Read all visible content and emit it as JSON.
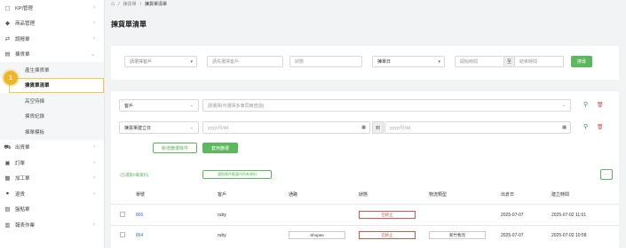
{
  "sidebar": {
    "items": [
      {
        "icon": "kpi-icon",
        "glyph": "▢",
        "label": "KPI管理"
      },
      {
        "icon": "cube-icon",
        "glyph": "◆",
        "label": "商品管理"
      },
      {
        "icon": "swap-icon",
        "glyph": "⇄",
        "label": "調撥單"
      },
      {
        "icon": "package-icon",
        "glyph": "▤",
        "label": "揀貨單"
      }
    ],
    "sub_items": [
      {
        "label": "產生揀貨單"
      },
      {
        "label": "揀貨單清單"
      },
      {
        "label": "高空待揀"
      },
      {
        "label": "揀貨紀錄"
      },
      {
        "label": "揀單模板"
      }
    ],
    "items_after": [
      {
        "icon": "truck-icon",
        "glyph": "⛟",
        "label": "出貨單"
      },
      {
        "icon": "order-icon",
        "glyph": "▣",
        "label": "訂單"
      },
      {
        "icon": "factory-icon",
        "glyph": "▦",
        "label": "加工單"
      },
      {
        "icon": "return-icon",
        "glyph": "●",
        "label": "退貨"
      },
      {
        "icon": "inventory-icon",
        "glyph": "▧",
        "label": "盤點單"
      },
      {
        "icon": "report-icon",
        "glyph": "▥",
        "label": "報表作業"
      }
    ],
    "step_badge": "1"
  },
  "breadcrumb": {
    "home_glyph": "⌂",
    "sep": "/",
    "parent": "揀貨單",
    "current": "揀貨單清單"
  },
  "page_title": "揀貨單清單",
  "filter": {
    "customer_select": "請選擇客戶",
    "product_placeholder": "請先選擇客戶",
    "status_placeholder": "狀態",
    "date_type": "揀單日",
    "start_placeholder": "開始時間",
    "to_label": "至",
    "end_placeholder": "結束時間",
    "search_label": "搜尋"
  },
  "conditions": {
    "row1_field": "客戶",
    "row1_value": "請選擇(可選擇多筆同時查詢)",
    "row2_field": "揀貨單建立日",
    "date_placeholder": "yyyy/月/dd",
    "to_label": "到",
    "add_condition": "新增篩選條件",
    "apply": "套用篩選"
  },
  "selection": {
    "selected_text": "(已選取0筆資料)",
    "select_all_text": "選取條件範圍內所有資料",
    "more_glyph": "···"
  },
  "table": {
    "headers": [
      "單號",
      "客戶",
      "通路",
      "狀態",
      "物流類型",
      "出倉日",
      "建立時間"
    ],
    "rows": [
      {
        "id": "865",
        "customer": "ruby",
        "channel": "",
        "status": "已終止",
        "logistics": "",
        "out_date": "2025-07-07",
        "created": "2025-07-02 11:01"
      },
      {
        "id": "864",
        "customer": "ruby",
        "channel": "Shopee",
        "status": "已終止",
        "logistics": "新竹物流",
        "out_date": "2025-07-07",
        "created": "2025-07-02 10:58"
      }
    ]
  },
  "colors": {
    "accent": "#5cb85c",
    "danger": "#d9534f",
    "highlight": "#f2c94c",
    "link": "#3b6fd1"
  }
}
